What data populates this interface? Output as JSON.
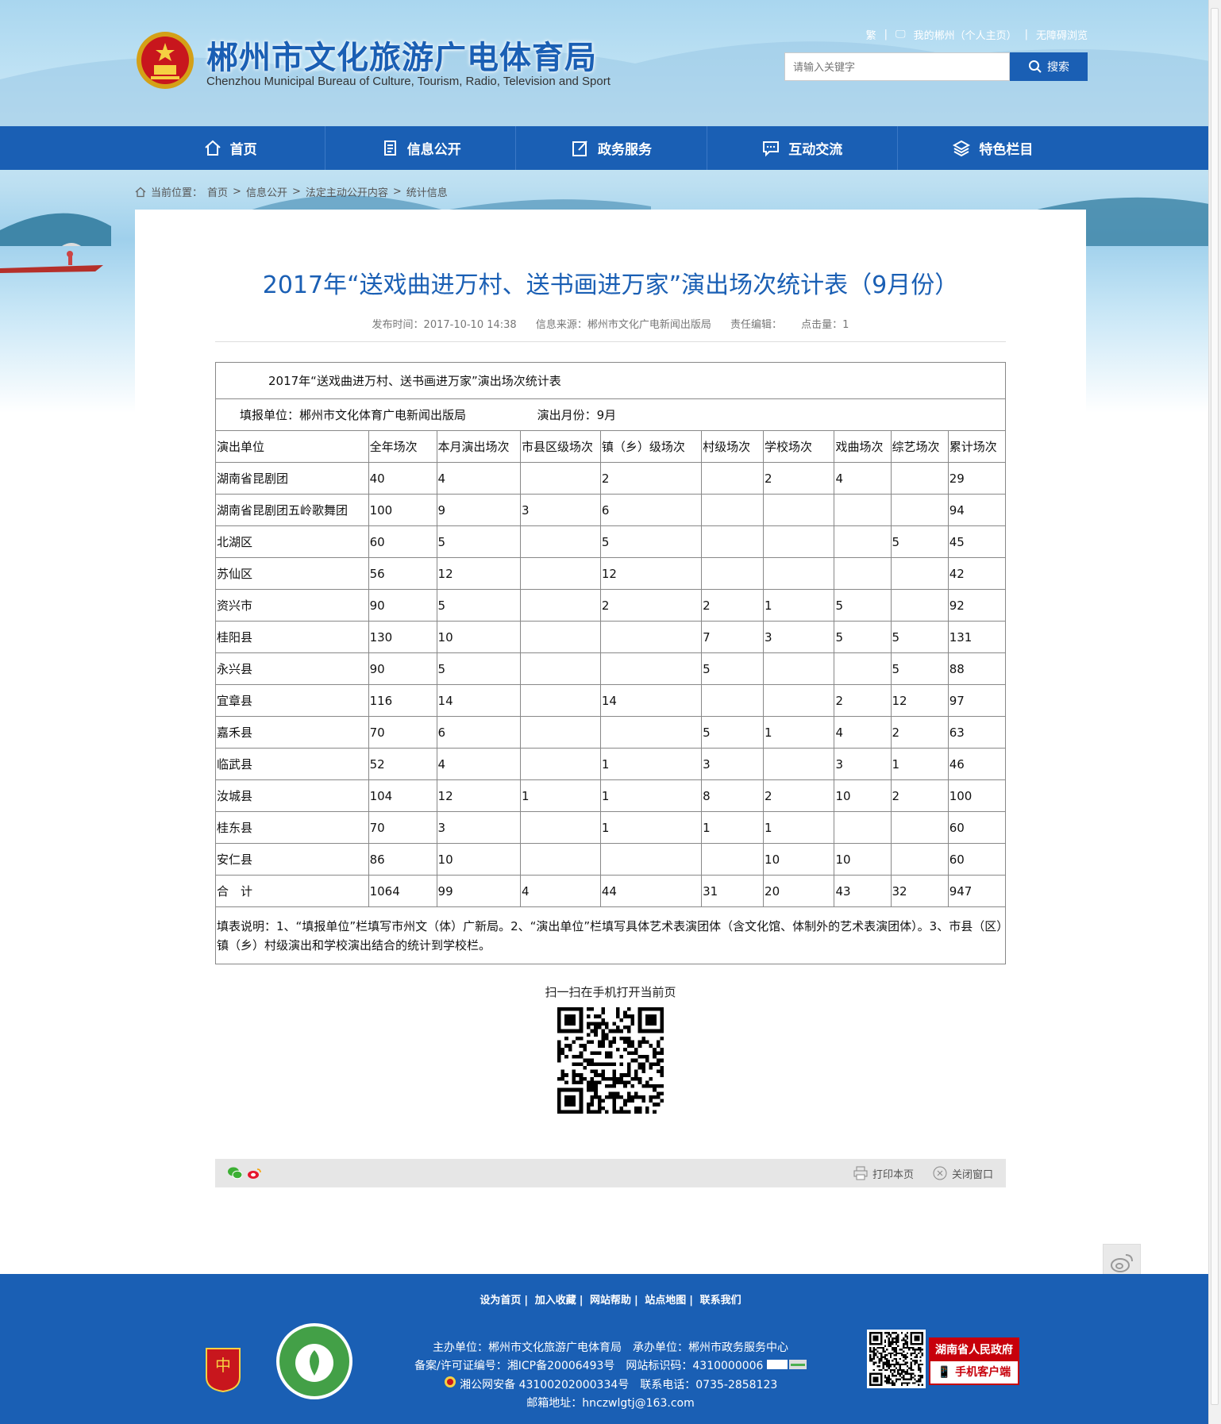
{
  "header": {
    "title": "郴州市文化旅游广电体育局",
    "subtitle": "Chenzhou Municipal Bureau of Culture, Tourism, Radio, Television and Sport",
    "toplinks": [
      "繁",
      "我的郴州（个人主页）",
      "无障碍浏览"
    ],
    "search_placeholder": "请输入关键字",
    "search_label": "搜索"
  },
  "nav": [
    "首页",
    "信息公开",
    "政务服务",
    "互动交流",
    "特色栏目"
  ],
  "breadcrumb": {
    "prefix": "当前位置：",
    "items": [
      "首页",
      "信息公开",
      "法定主动公开内容",
      "统计信息"
    ]
  },
  "article": {
    "title": "2017年“送戏曲进万村、送书画进万家”演出场次统计表（9月份）",
    "publish_time": "发布时间：2017-10-10 14:38",
    "source": "信息来源：郴州市文化广电新闻出版局",
    "editor": "责任编辑：",
    "clicks": "点击量：1"
  },
  "table": {
    "title": "2017年“送戏曲进万村、送书画进万家”演出场次统计表",
    "unit": "填报单位：郴州市文化体育广电新闻出版局",
    "month": "演出月份：9月",
    "headers": [
      "演出单位",
      "全年场次",
      "本月演出场次",
      "市县区级场次",
      "镇（乡）级场次",
      "村级场次",
      "学校场次",
      "戏曲场次",
      "综艺场次",
      "累计场次"
    ],
    "rows": [
      [
        "湖南省昆剧团",
        "40",
        "4",
        "",
        "2",
        "",
        "2",
        "4",
        "",
        "29"
      ],
      [
        "湖南省昆剧团五岭歌舞团",
        "100",
        "9",
        "3",
        "6",
        "",
        "",
        "",
        "",
        "94"
      ],
      [
        "北湖区",
        "60",
        "5",
        "",
        "5",
        "",
        "",
        "",
        "5",
        "45"
      ],
      [
        "苏仙区",
        "56",
        "12",
        "",
        "12",
        "",
        "",
        "",
        "",
        "42"
      ],
      [
        "资兴市",
        "90",
        "5",
        "",
        "2",
        "2",
        "1",
        "5",
        "",
        "92"
      ],
      [
        "桂阳县",
        "130",
        "10",
        "",
        "",
        "7",
        "3",
        "5",
        "5",
        "131"
      ],
      [
        "永兴县",
        "90",
        "5",
        "",
        "",
        "5",
        "",
        "",
        "5",
        "88"
      ],
      [
        "宜章县",
        "116",
        "14",
        "",
        "14",
        "",
        "",
        "2",
        "12",
        "97"
      ],
      [
        "嘉禾县",
        "70",
        "6",
        "",
        "",
        "5",
        "1",
        "4",
        "2",
        "63"
      ],
      [
        "临武县",
        "52",
        "4",
        "",
        "1",
        "3",
        "",
        "3",
        "1",
        "46"
      ],
      [
        "汝城县",
        "104",
        "12",
        "1",
        "1",
        "8",
        "2",
        "10",
        "2",
        "100"
      ],
      [
        "桂东县",
        "70",
        "3",
        "",
        "1",
        "1",
        "1",
        "",
        "",
        "60"
      ],
      [
        "安仁县",
        "86",
        "10",
        "",
        "",
        "",
        "10",
        "10",
        "",
        "60"
      ],
      [
        "合　计",
        "1064",
        "99",
        "4",
        "44",
        "31",
        "20",
        "43",
        "32",
        "947"
      ]
    ],
    "note": "填表说明：1、“填报单位”栏填写市州文（体）广新局。2、“演出单位”栏填写具体艺术表演团体（含文化馆、体制外的艺术表演团体）。3、市县（区）镇（乡）村级演出和学校演出结合的统计到学校栏。"
  },
  "qr_label": "扫一扫在手机打开当前页",
  "sharebar": {
    "print": "打印本页",
    "close": "关闭窗口"
  },
  "footer": {
    "links": [
      "设为首页",
      "加入收藏",
      "网站帮助",
      "站点地图",
      "联系我们"
    ],
    "line1": "主办单位：郴州市文化旅游广电体育局　承办单位：郴州市政务服务中心",
    "line2": "备案/许可证编号：湘ICP备20006493号　网站标识码：4310000006",
    "line3": "湘公网安备 43100202000334号　联系电话：0735-2858123",
    "line4": "邮箱地址：hnczwlgtj@163.com",
    "gov_app_line1": "湖南省人民政府",
    "gov_app_line2": "手机客户端"
  }
}
